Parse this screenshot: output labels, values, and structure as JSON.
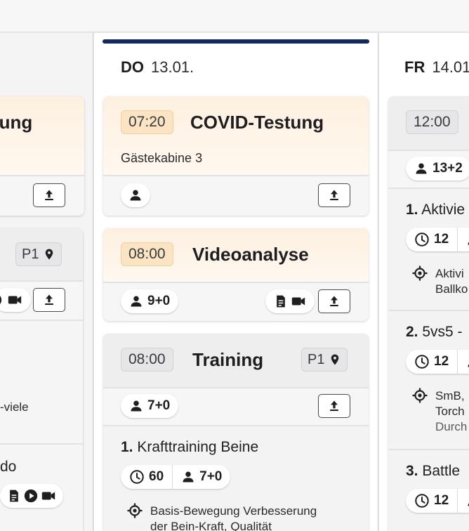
{
  "left_column": {
    "card1": {
      "title_partial": "tung"
    },
    "card2": {
      "location_label": "P1",
      "text_partial": "-viele",
      "title_partial": "do"
    }
  },
  "middle_column": {
    "day": {
      "dow": "DO",
      "date": "13.01."
    },
    "cards": [
      {
        "time": "07:20",
        "title": "COVID-Testung",
        "subtitle": "Gästekabine 3"
      },
      {
        "time": "08:00",
        "title": "Videoanalyse",
        "participants": "9+0"
      },
      {
        "time": "08:00",
        "title": "Training",
        "location": "P1",
        "participants": "7+0",
        "exercise": {
          "number": "1.",
          "name": "Krafttraining Beine",
          "duration": "60",
          "participants": "7+0",
          "goal_line1": "Basis-Bewegung Verbesserung",
          "goal_line2": "der Bein-Kraft, Qualität"
        }
      }
    ]
  },
  "right_column": {
    "day": {
      "dow": "FR",
      "date": "14.01."
    },
    "card": {
      "time": "12:00",
      "participants": "13+2"
    },
    "exercises": [
      {
        "number": "1.",
        "name": "Aktivie",
        "duration": "12",
        "goal_line1": "Aktivi",
        "goal_line2": "Ballko"
      },
      {
        "number": "2.",
        "name": "5vs5 -",
        "duration": "12",
        "goal_line1": "SmB,",
        "goal_line2": "Torch",
        "goal_line3": "Durch"
      },
      {
        "number": "3.",
        "name": "Battle",
        "duration": "12"
      }
    ]
  },
  "colors": {
    "day_bar": "#13295b",
    "warm_header": "#fdf0e0",
    "time_badge_orange": "#fbe4c4"
  }
}
